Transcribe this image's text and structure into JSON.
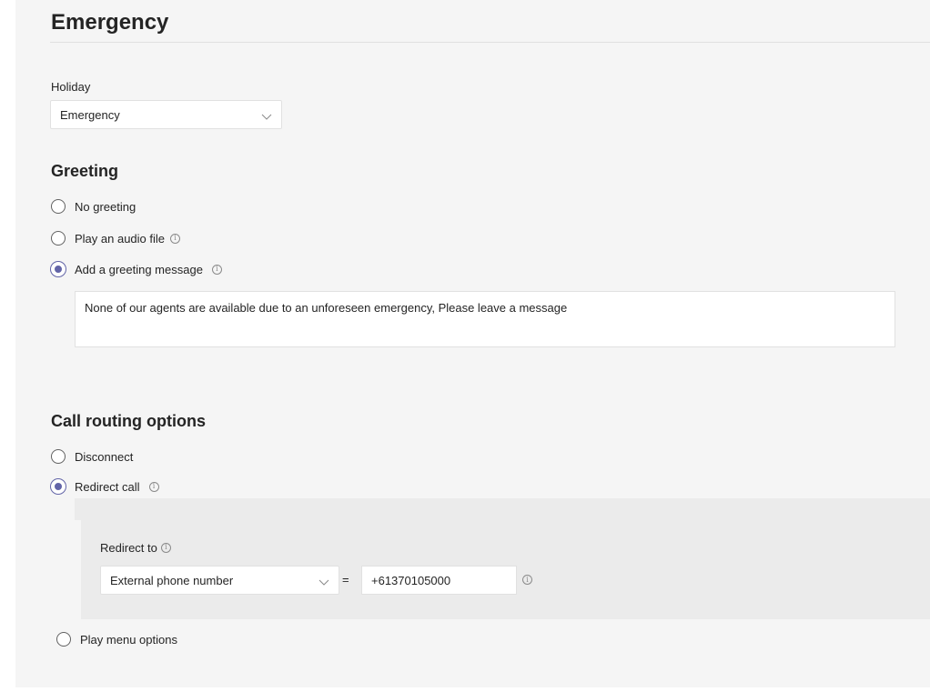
{
  "page": {
    "title": "Emergency"
  },
  "holiday": {
    "label": "Holiday",
    "selected": "Emergency"
  },
  "greeting": {
    "title": "Greeting",
    "options": [
      {
        "label": "No greeting",
        "checked": false,
        "info": false
      },
      {
        "label": "Play an audio file",
        "checked": false,
        "info": true
      },
      {
        "label": "Add a greeting message",
        "checked": true,
        "info": true
      }
    ],
    "message": "None of our agents are available due to an unforeseen emergency, Please leave a message"
  },
  "routing": {
    "title": "Call routing options",
    "options": [
      {
        "label": "Disconnect",
        "checked": false
      },
      {
        "label": "Redirect call",
        "checked": true
      },
      {
        "label": "Play menu options",
        "checked": false
      }
    ],
    "redirect": {
      "label": "Redirect to",
      "target_type": "External phone number",
      "equals": "=",
      "phone_number": "+61370105000"
    }
  },
  "icons": {
    "info": "info-icon",
    "chevron": "chevron-down-icon"
  },
  "colors": {
    "accent": "#6264a7",
    "panel": "#f5f5f5",
    "redirect_box": "#ebebeb"
  }
}
